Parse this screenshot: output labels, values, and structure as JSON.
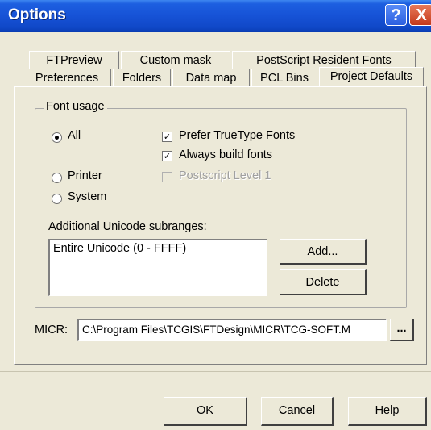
{
  "window": {
    "title": "Options",
    "help_button": "?",
    "close_button": "X"
  },
  "tabs": {
    "back_row": [
      "FTPreview",
      "Custom mask",
      "PostScript Resident Fonts"
    ],
    "front_row": [
      "Preferences",
      "Folders",
      "Data map",
      "PCL Bins",
      "Project Defaults"
    ],
    "active": "Project Defaults"
  },
  "font_usage": {
    "group_label": "Font usage",
    "radios": [
      {
        "label": "All",
        "checked": true
      },
      {
        "label": "Printer",
        "checked": false
      },
      {
        "label": "System",
        "checked": false
      }
    ],
    "checkboxes": [
      {
        "label": "Prefer TrueType Fonts",
        "checked": true,
        "enabled": true
      },
      {
        "label": "Always build fonts",
        "checked": true,
        "enabled": true
      },
      {
        "label": "Postscript Level 1",
        "checked": false,
        "enabled": false
      }
    ],
    "subranges_label": "Additional Unicode subranges:",
    "subranges": [
      "Entire Unicode (0 - FFFF)"
    ],
    "add_button": "Add...",
    "delete_button": "Delete"
  },
  "micr": {
    "label": "MICR:",
    "value": "C:\\Program Files\\TCGIS\\FTDesign\\MICR\\TCG-SOFT.M",
    "browse_button": "..."
  },
  "footer": {
    "ok": "OK",
    "cancel": "Cancel",
    "help": "Help"
  }
}
